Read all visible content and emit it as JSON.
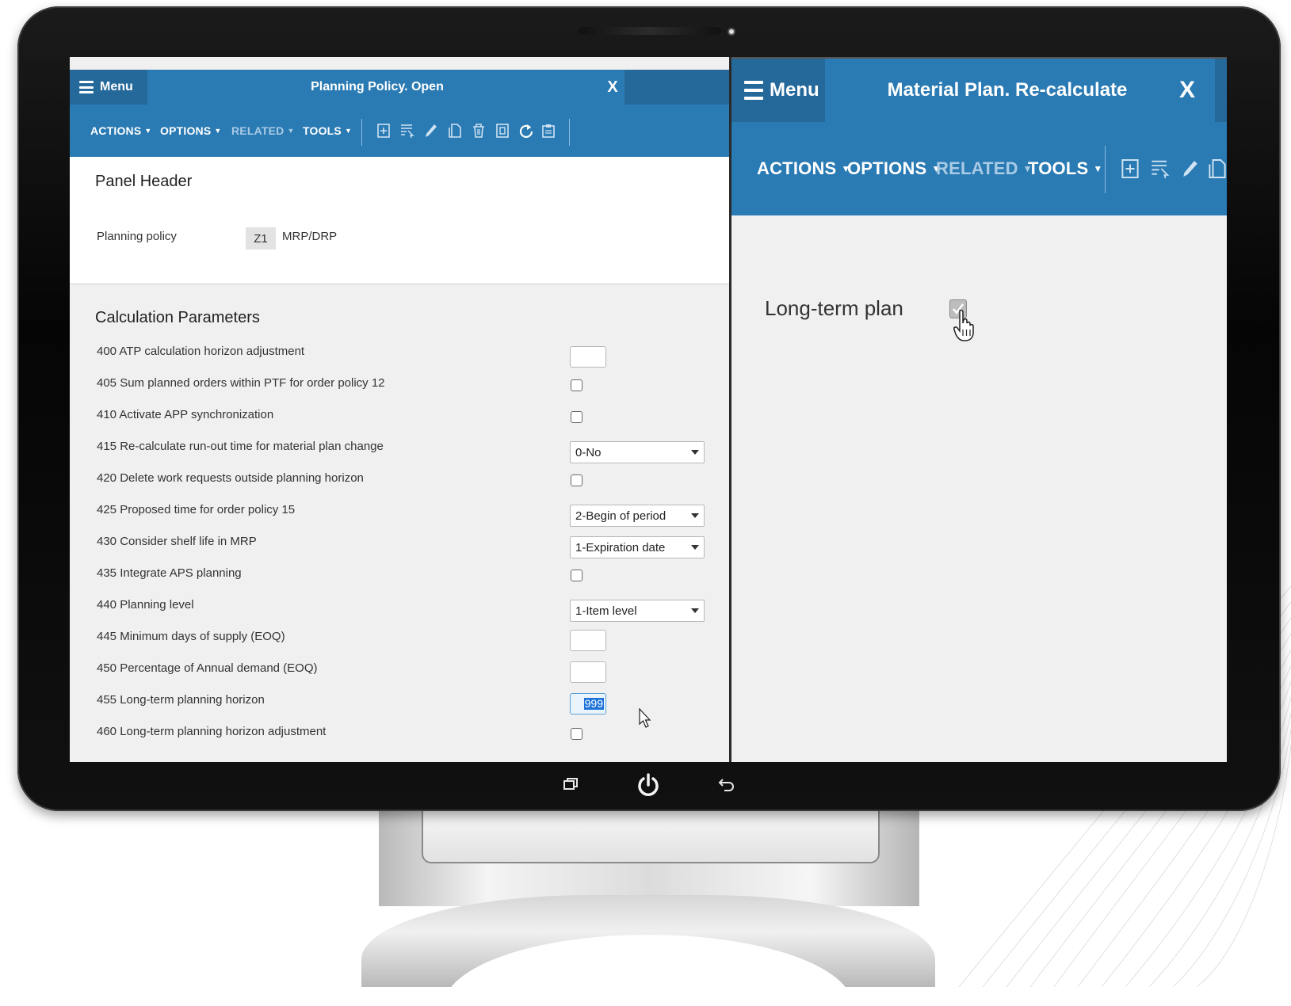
{
  "left_window": {
    "menu_label": "Menu",
    "title": "Planning Policy. Open",
    "close_label": "X",
    "toolbar": {
      "actions": "ACTIONS",
      "options": "OPTIONS",
      "related": "RELATED",
      "tools": "TOOLS"
    },
    "panel_header": {
      "heading": "Panel Header",
      "policy_label": "Planning policy",
      "policy_code": "Z1",
      "policy_desc": "MRP/DRP"
    },
    "calc": {
      "heading": "Calculation Parameters",
      "rows": [
        {
          "label": "400 ATP calculation horizon adjustment",
          "control": "text",
          "value": ""
        },
        {
          "label": "405 Sum planned orders within PTF for order policy 12",
          "control": "checkbox",
          "checked": false
        },
        {
          "label": "410 Activate APP synchronization",
          "control": "checkbox",
          "checked": false
        },
        {
          "label": "415 Re-calculate run-out time for material plan change",
          "control": "select",
          "value": "0-No"
        },
        {
          "label": "420 Delete work requests outside planning horizon",
          "control": "checkbox",
          "checked": false
        },
        {
          "label": "425 Proposed time for order policy 15",
          "control": "select",
          "value": "2-Begin of period"
        },
        {
          "label": "430 Consider shelf life in MRP",
          "control": "select",
          "value": "1-Expiration date"
        },
        {
          "label": "435 Integrate APS planning",
          "control": "checkbox",
          "checked": false
        },
        {
          "label": "440 Planning level",
          "control": "select",
          "value": "1-Item level"
        },
        {
          "label": "445 Minimum days of supply (EOQ)",
          "control": "text",
          "value": ""
        },
        {
          "label": "450 Percentage of Annual demand (EOQ)",
          "control": "text",
          "value": ""
        },
        {
          "label": "455 Long-term planning horizon",
          "control": "text",
          "value": "999"
        },
        {
          "label": "460 Long-term planning horizon adjustment",
          "control": "checkbox",
          "checked": false
        }
      ]
    }
  },
  "right_window": {
    "menu_label": "Menu",
    "title": "Material Plan. Re-calculate",
    "close_label": "X",
    "toolbar": {
      "actions": "ACTIONS",
      "options": "OPTIONS",
      "related": "RELATED",
      "tools": "TOOLS"
    },
    "long_term_label": "Long-term plan",
    "long_term_checked": true
  },
  "colors": {
    "header_blue": "#2a7ab3",
    "menu_blue": "#25699b",
    "disabled_text": "#a9cbe5"
  },
  "icons": [
    "menu-icon",
    "close-icon",
    "add-icon",
    "select-icon",
    "edit-icon",
    "copy-icon",
    "delete-icon",
    "duplicate-icon",
    "refresh-icon",
    "clipboard-icon",
    "restore-icon",
    "power-icon",
    "back-icon",
    "mouse-pointer-icon",
    "hand-pointer-icon"
  ]
}
